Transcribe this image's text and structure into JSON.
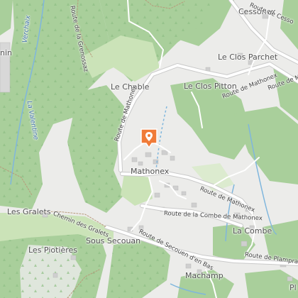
{
  "map": {
    "place_labels": {
      "cessonex": "Cessonex",
      "le_clos_parchet": "Le Clos Parchet",
      "le_chable": "Le Chable",
      "le_clos_pitton": "Le Clos Pitton",
      "mathonex": "Mathonex",
      "les_gralets": "Les Gralets",
      "sous_secouan": "Sous Secouan",
      "les_piotieres": "Les Piotières",
      "la_combe": "La Combe",
      "machamp": "Machamp",
      "left_edge_fragment": "nin",
      "bottom_right_fragment": "Pl"
    },
    "road_labels": {
      "route_de_cessonex": "Route de Cesso",
      "route_de_mathonex_ne": "Route de Mathonex",
      "route_de_mathonex_ne2": "Route de M",
      "route_de_mathonex_west": "Route de Mathonex",
      "route_de_mathonex_center": "Route de Mathonex",
      "route_de_la_combe": "Route de la Combe de Mathonex",
      "chemin_des_gralets": "Chemin des Gralets",
      "route_de_secouen": "Route de Secouen d'en Bas",
      "route_de_plampraz": "Route de Plampraz",
      "route_a_la_grenossaz": "Route de la Grenossaz"
    },
    "water_labels": {
      "verchaix": "Verchaix",
      "la_valentine": "La Valentine"
    },
    "marker_icon": "location-pin-icon",
    "colors": {
      "marker": "#f07b38",
      "forest": "#a9cf9b",
      "meadow": "#cbe3b8",
      "water": "#7fb6dd",
      "road": "#ffffff",
      "background": "#ececea"
    }
  }
}
